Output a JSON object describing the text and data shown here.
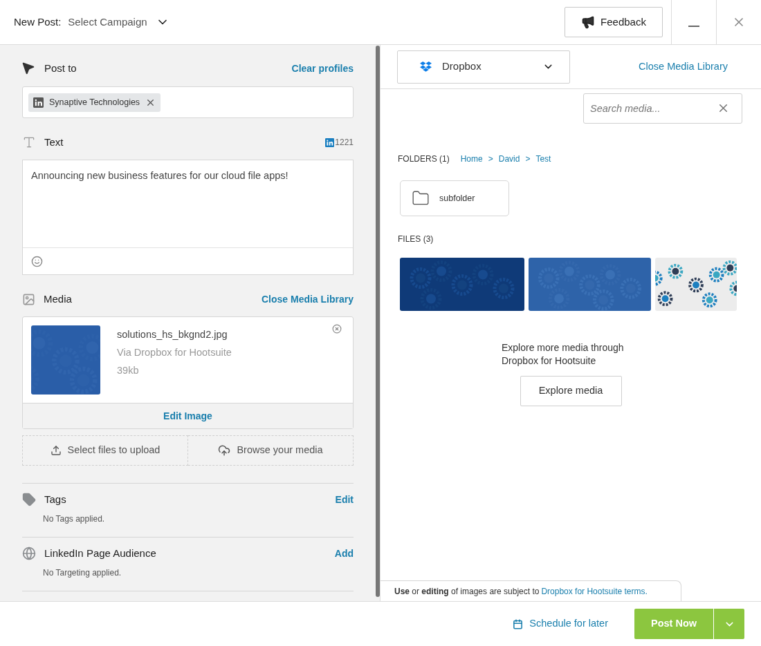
{
  "header": {
    "label": "New Post:",
    "campaign": "Select Campaign",
    "feedback": "Feedback"
  },
  "post_to": {
    "title": "Post to",
    "action": "Clear profiles",
    "profiles": [
      {
        "name": "Synaptive Technologies"
      }
    ]
  },
  "text": {
    "title": "Text",
    "counter": "1221",
    "value": "Announcing new business features for our cloud file apps!"
  },
  "media": {
    "title": "Media",
    "action": "Close Media Library",
    "item": {
      "filename": "solutions_hs_bkgnd2.jpg",
      "source": "Via Dropbox for Hootsuite",
      "size": "39kb",
      "kind": "picture"
    },
    "edit": "Edit Image",
    "upload": [
      {
        "kind": "upload",
        "label": "Select files to upload"
      },
      {
        "kind": "cloud",
        "label": "Browse your media"
      }
    ]
  },
  "sections": [
    {
      "kind": "tag",
      "title": "Tags",
      "action": "Edit",
      "note": "No Tags applied."
    },
    {
      "kind": "globe",
      "title": "LinkedIn Page Audience",
      "action": "Add",
      "note": "No Targeting applied."
    }
  ],
  "library": {
    "source": "Dropbox",
    "close": "Close Media Library",
    "search_placeholder": "Search media...",
    "folders_label": "FOLDERS (1)",
    "separator": ">",
    "breadcrumb": [
      "Home",
      "David",
      "Test"
    ],
    "folders": [
      {
        "name": "subfolder"
      }
    ],
    "files_label": "FILES (3)",
    "explore_text": "Explore more media through Dropbox for Hootsuite",
    "explore_button": "Explore media",
    "terms": "**Use** or **editing** of images are subject to ",
    "terms_link": "Dropbox for Hootsuite terms."
  },
  "footer": {
    "schedule": "Schedule for later",
    "post_now": "Post Now"
  }
}
